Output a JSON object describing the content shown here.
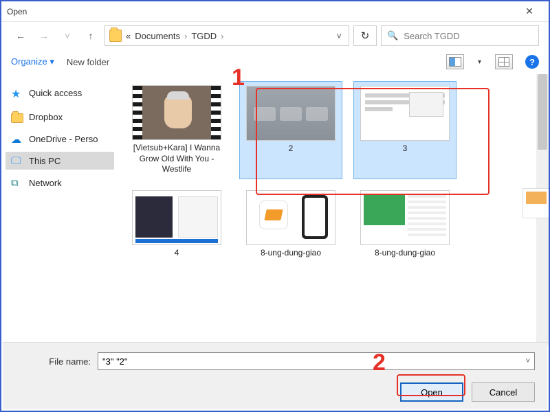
{
  "window": {
    "title": "Open",
    "close_glyph": "✕"
  },
  "nav": {
    "back_glyph": "←",
    "fwd_glyph": "→",
    "up_glyph": "↑",
    "dd_glyph": "˅",
    "refresh_glyph": "↻",
    "crumb_prefix": "«",
    "crumb1": "Documents",
    "crumb2": "TGDD",
    "sep": "›"
  },
  "search": {
    "icon": "🔍",
    "placeholder": "Search TGDD"
  },
  "toolbar": {
    "organize": "Organize ▾",
    "new_folder": "New folder",
    "view_dd": "▾",
    "help": "?"
  },
  "sidebar": {
    "items": [
      {
        "label": "Quick access",
        "icon": "star"
      },
      {
        "label": "Dropbox",
        "icon": "folder"
      },
      {
        "label": "OneDrive - Perso",
        "icon": "cloud"
      },
      {
        "label": "This PC",
        "icon": "monitor",
        "selected": true
      },
      {
        "label": "Network",
        "icon": "net"
      }
    ]
  },
  "files": [
    {
      "name": "[Vietsub+Kara] I Wanna Grow Old With You - Westlife",
      "kind": "video",
      "selected": false
    },
    {
      "name": "2",
      "kind": "gray",
      "selected": true
    },
    {
      "name": "3",
      "kind": "doc",
      "selected": true
    },
    {
      "name": "4",
      "kind": "code",
      "selected": false
    },
    {
      "name": "8-ung-dung-giao",
      "kind": "app",
      "selected": false
    },
    {
      "name": "8-ung-dung-giao",
      "kind": "green",
      "selected": false
    }
  ],
  "bottom": {
    "filename_label": "File name:",
    "filename_value": "\"3\" \"2\"",
    "open_label": "Open",
    "cancel_label": "Cancel"
  },
  "annotations": {
    "a1": "1",
    "a2": "2"
  }
}
